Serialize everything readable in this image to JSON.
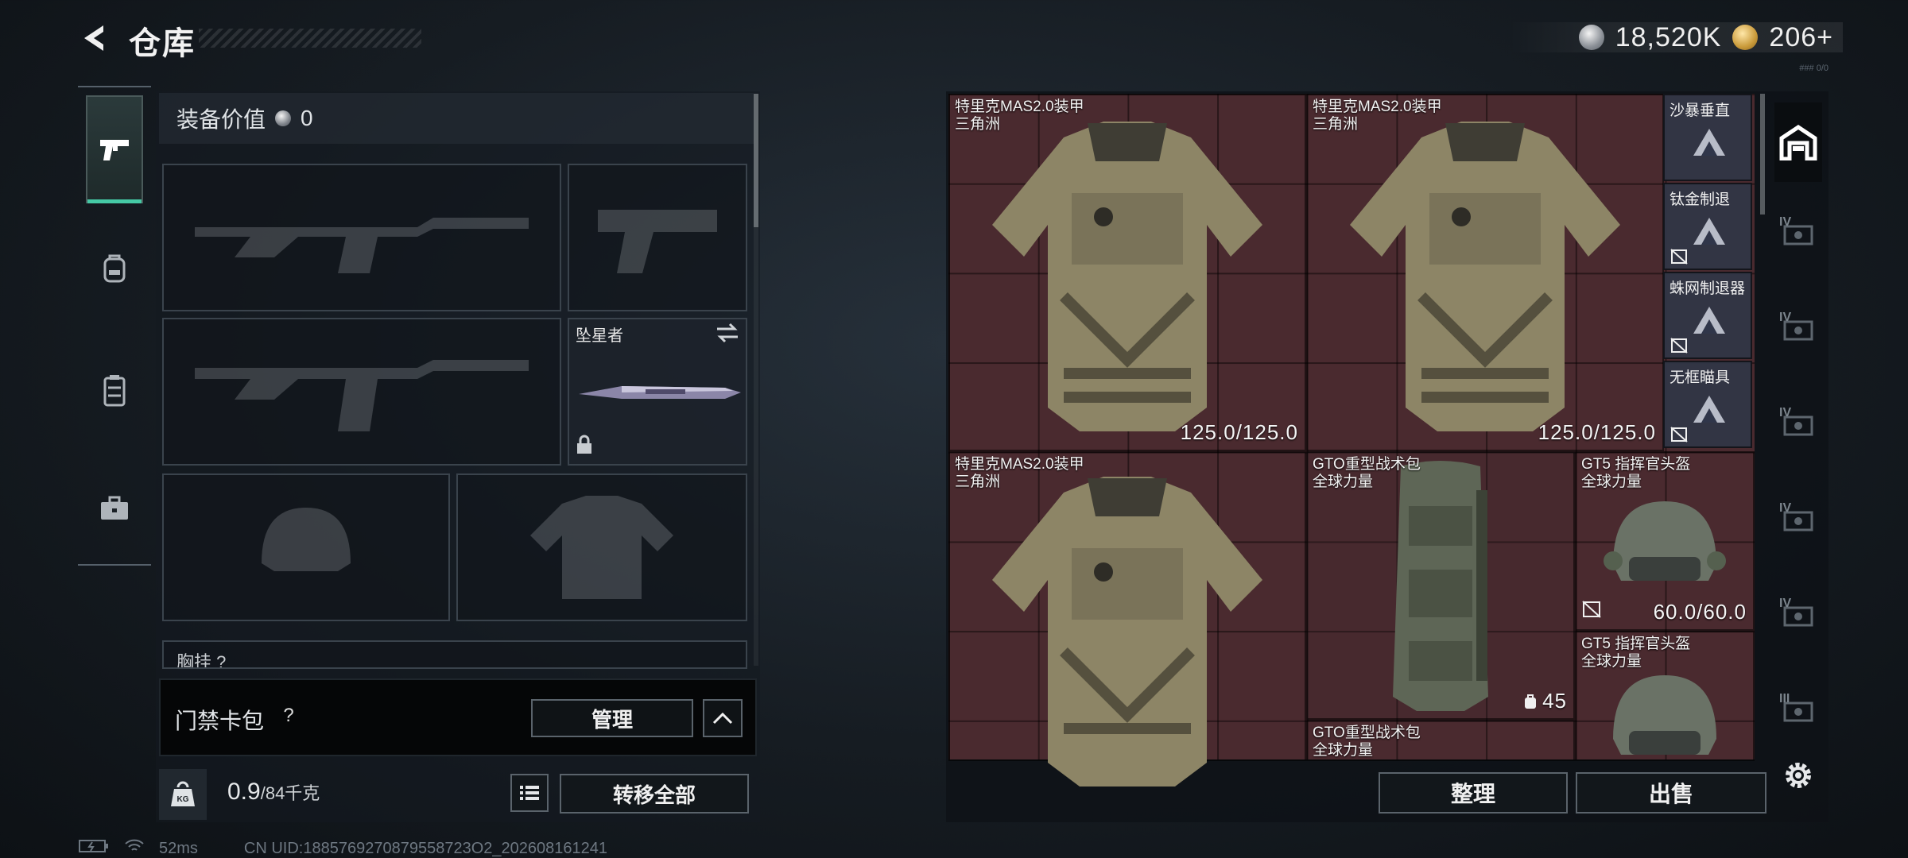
{
  "header": {
    "title": "仓库",
    "currency_silver": "18,520K",
    "currency_gold": "206+",
    "sub_tag": "### 0/0"
  },
  "left_tabs": [
    {
      "name": "weapons",
      "icon": "pistol-icon",
      "active": true
    },
    {
      "name": "gear",
      "icon": "backpack-icon",
      "active": false
    },
    {
      "name": "rig",
      "icon": "vest-icon",
      "active": false
    },
    {
      "name": "case",
      "icon": "briefcase-icon",
      "active": false
    }
  ],
  "loadout": {
    "equip_value_label": "装备价值",
    "equip_value": "0",
    "knife_name": "坠星者",
    "chest_rig_label": "胸挂 ?"
  },
  "keycard": {
    "label": "门禁卡包",
    "help": "?",
    "manage_label": "管理"
  },
  "weight": {
    "kg_label": "KG",
    "current": "0.9",
    "max": "/84千克"
  },
  "transfer_all_label": "转移全部",
  "status": {
    "ping": "52ms",
    "uid": "CN UID:1885769270879558723O2_202608161241"
  },
  "warehouse": {
    "items": [
      {
        "line1": "特里克MAS2.0装甲",
        "line2": "三角洲",
        "durability": "125.0/125.0",
        "type": "armor"
      },
      {
        "line1": "特里克MAS2.0装甲",
        "line2": "三角洲",
        "durability": "125.0/125.0",
        "type": "armor"
      },
      {
        "line1": "特里克MAS2.0装甲",
        "line2": "三角洲",
        "durability": "",
        "type": "armor"
      },
      {
        "line1": "GTO重型战术包",
        "line2": "全球力量",
        "count": "45",
        "type": "backpack"
      },
      {
        "line1": "GT5 指挥官头盔",
        "line2": "全球力量",
        "durability": "60.0/60.0",
        "type": "helmet"
      },
      {
        "line1": "GT5 指挥官头盔",
        "line2": "全球力量",
        "type": "helmet"
      },
      {
        "line1": "GTO重型战术包",
        "line2": "全球力量",
        "type": "backpack"
      }
    ],
    "attachments": [
      {
        "name": "沙暴垂直"
      },
      {
        "name": "钛金制退"
      },
      {
        "name": "蛛网制退器"
      },
      {
        "name": "无框瞄具"
      }
    ]
  },
  "storage_tabs": [
    {
      "level": "",
      "active": true
    },
    {
      "level": "IV",
      "active": false
    },
    {
      "level": "IV",
      "active": false
    },
    {
      "level": "IV",
      "active": false
    },
    {
      "level": "IV",
      "active": false
    },
    {
      "level": "IV",
      "active": false
    },
    {
      "level": "III",
      "active": false
    }
  ],
  "actions": {
    "organize": "整理",
    "sell": "出售"
  },
  "colors": {
    "accent": "#45c9a5",
    "grid_bg": "#4a2a2f",
    "panel": "#12171b"
  }
}
